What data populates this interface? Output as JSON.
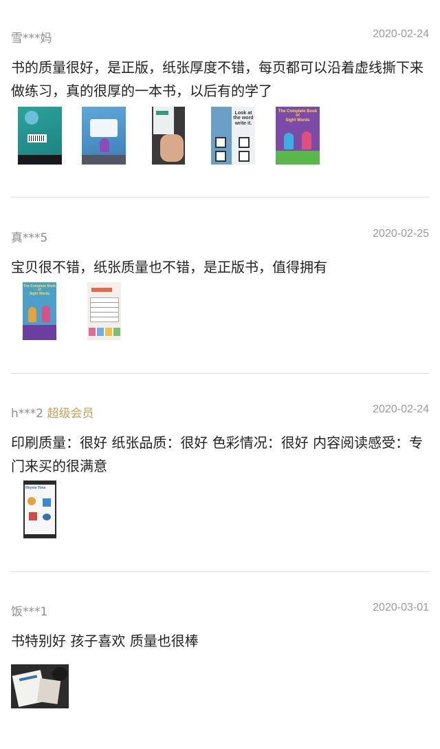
{
  "reviews": [
    {
      "user": "雪***妈",
      "badge": "",
      "date": "2020-02-24",
      "text": "书的质量很好，是正版，纸张厚度不错，每页都可以沿着虚线撕下来做练习，真的很厚的一本书，以后有的学了",
      "photos": [
        {
          "name": "book-back-cover-photo",
          "label": ""
        },
        {
          "name": "book-cover-blue-photo",
          "label": ""
        },
        {
          "name": "page-in-hand-photo",
          "label": ""
        },
        {
          "name": "worksheet-page-photo",
          "label": "Look at\nthe word\nwrite it."
        },
        {
          "name": "sight-words-cover-photo",
          "label": "The Complete Book of\nSight Words"
        }
      ]
    },
    {
      "user": "真***5",
      "badge": "",
      "date": "2020-02-25",
      "text": "宝贝很不错，纸张质量也不错，是正版书，值得拥有",
      "photos": [
        {
          "name": "sight-words-cover-photo",
          "label": "The Complete Book of\nSight Words"
        },
        {
          "name": "worksheet-page-photo",
          "label": ""
        }
      ]
    },
    {
      "user": "h***2",
      "badge": "超级会员",
      "date": "2020-02-24",
      "text": "印刷质量：很好 纸张品质：很好 色彩情况：很好 内容阅读感受：专门来买的很满意",
      "photos": [
        {
          "name": "rhyme-time-page-photo",
          "label": "Rhyme Time"
        }
      ]
    },
    {
      "user": "饭***1",
      "badge": "",
      "date": "2020-03-01",
      "text": "书特别好 孩子喜欢 质量也很棒",
      "photos": [
        {
          "name": "book-on-table-photo",
          "label": ""
        }
      ]
    }
  ]
}
